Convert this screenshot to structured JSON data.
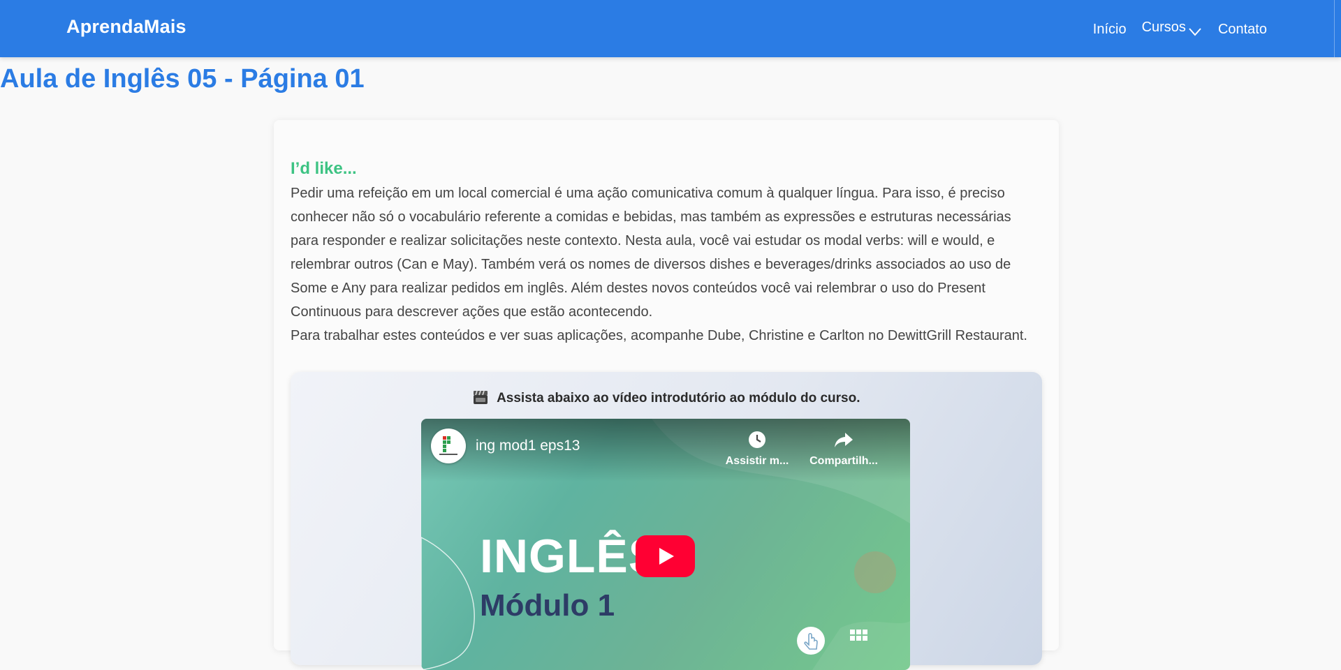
{
  "header": {
    "brand": "AprendaMais",
    "nav": {
      "home": "Início",
      "courses": "Cursos",
      "contact": "Contato"
    }
  },
  "page": {
    "title": "Aula de Inglês 05 - Página 01"
  },
  "lesson": {
    "heading": "I’d like...",
    "paragraph1": "Pedir uma refeição em um local comercial é uma ação comunicativa comum à qualquer língua. Para isso, é preciso conhecer não só o vocabulário referente a comidas e bebidas, mas também as expressões e estruturas necessárias para responder e realizar solicitações neste contexto. Nesta aula, você vai estudar os modal verbs: will e would, e relembrar outros (Can e May). Também verá os nomes de diversos dishes e beverages/drinks associados ao uso de Some e Any para realizar pedidos em inglês. Além destes novos conteúdos você vai relembrar o uso do Present Continuous para descrever ações que estão acontecendo.",
    "paragraph2": "Para trabalhar estes conteúdos e ver suas aplicações, acompanhe Dube, Christine e Carlton no DewittGrill Restaurant."
  },
  "video": {
    "intro": "Assista abaixo ao vídeo introdutório ao módulo do curso.",
    "title": "ing mod1 eps13",
    "watch_later": "Assistir m...",
    "share": "Compartilh...",
    "thumb_title": "INGLÊS",
    "thumb_subtitle": "Módulo 1"
  },
  "colors": {
    "primary": "#2b7ce4",
    "accent_green": "#3dc383",
    "youtube_red": "#ff0033"
  },
  "icons": {
    "nav_dropdown": "chevron-down-icon",
    "intro": "clapper-board-icon",
    "watch_later": "clock-icon",
    "share": "share-arrow-icon",
    "play": "youtube-play-icon"
  }
}
